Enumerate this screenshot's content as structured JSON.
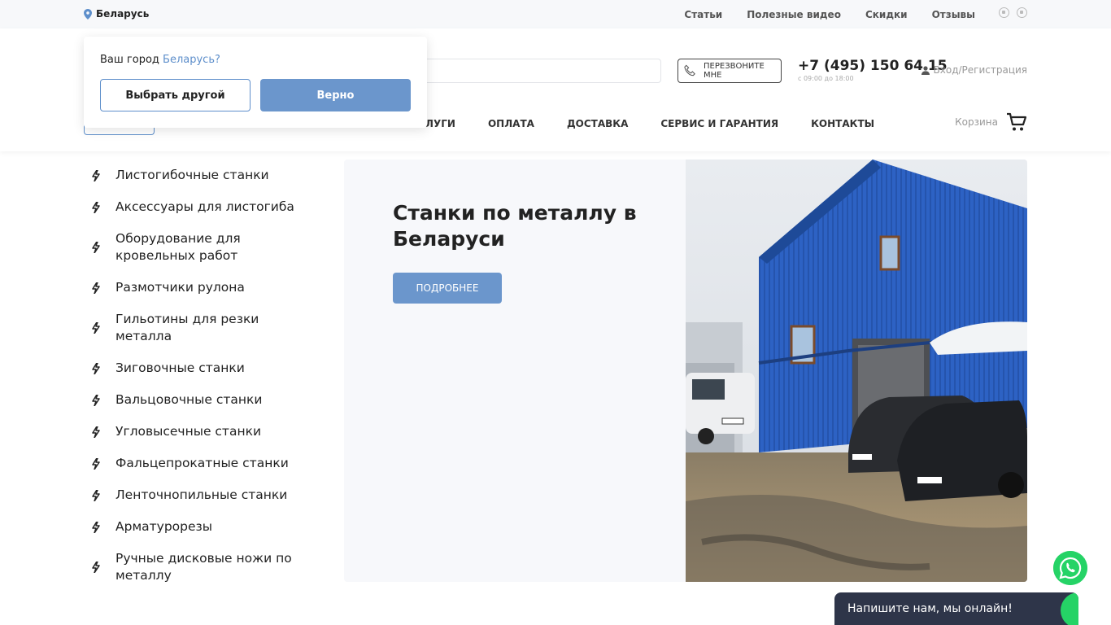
{
  "topbar": {
    "location": "Беларусь",
    "links": [
      "Статьи",
      "Полезные видео",
      "Скидки",
      "Отзывы"
    ]
  },
  "header": {
    "callback_label": "ПЕРЕЗВОНИТЕ МНЕ",
    "phone": "+7 (495) 150 64 15",
    "hours": "с 09:00 до 18:00",
    "login": "Вход/Регистрация",
    "cart": "Корзина",
    "nav": [
      "УСЛУГИ",
      "ОПЛАТА",
      "ДОСТАВКА",
      "СЕРВИС И ГАРАНТИЯ",
      "КОНТАКТЫ"
    ]
  },
  "city_popup": {
    "question": "Ваш город",
    "city": "Беларусь?",
    "other_label": "Выбрать другой",
    "yes_label": "Верно"
  },
  "catalog": [
    "Листогибочные станки",
    "Аксессуары для листогиба",
    "Оборудование для кровельных работ",
    "Размотчики рулона",
    "Гильотины для резки металла",
    "Зиговочные станки",
    "Вальцовочные станки",
    "Угловысечные станки",
    "Фальцепрокатные станки",
    "Ленточнопильные станки",
    "Арматурорезы",
    "Ручные дисковые ножи по металлу"
  ],
  "banner": {
    "title": "Станки по металлу в Беларуси",
    "button": "ПОДРОБНЕЕ"
  },
  "chat": {
    "text": "Напишите нам, мы онлайн!"
  },
  "colors": {
    "accent": "#6b96cc",
    "whatsapp": "#25d366",
    "chat_bg": "#2e3549"
  }
}
